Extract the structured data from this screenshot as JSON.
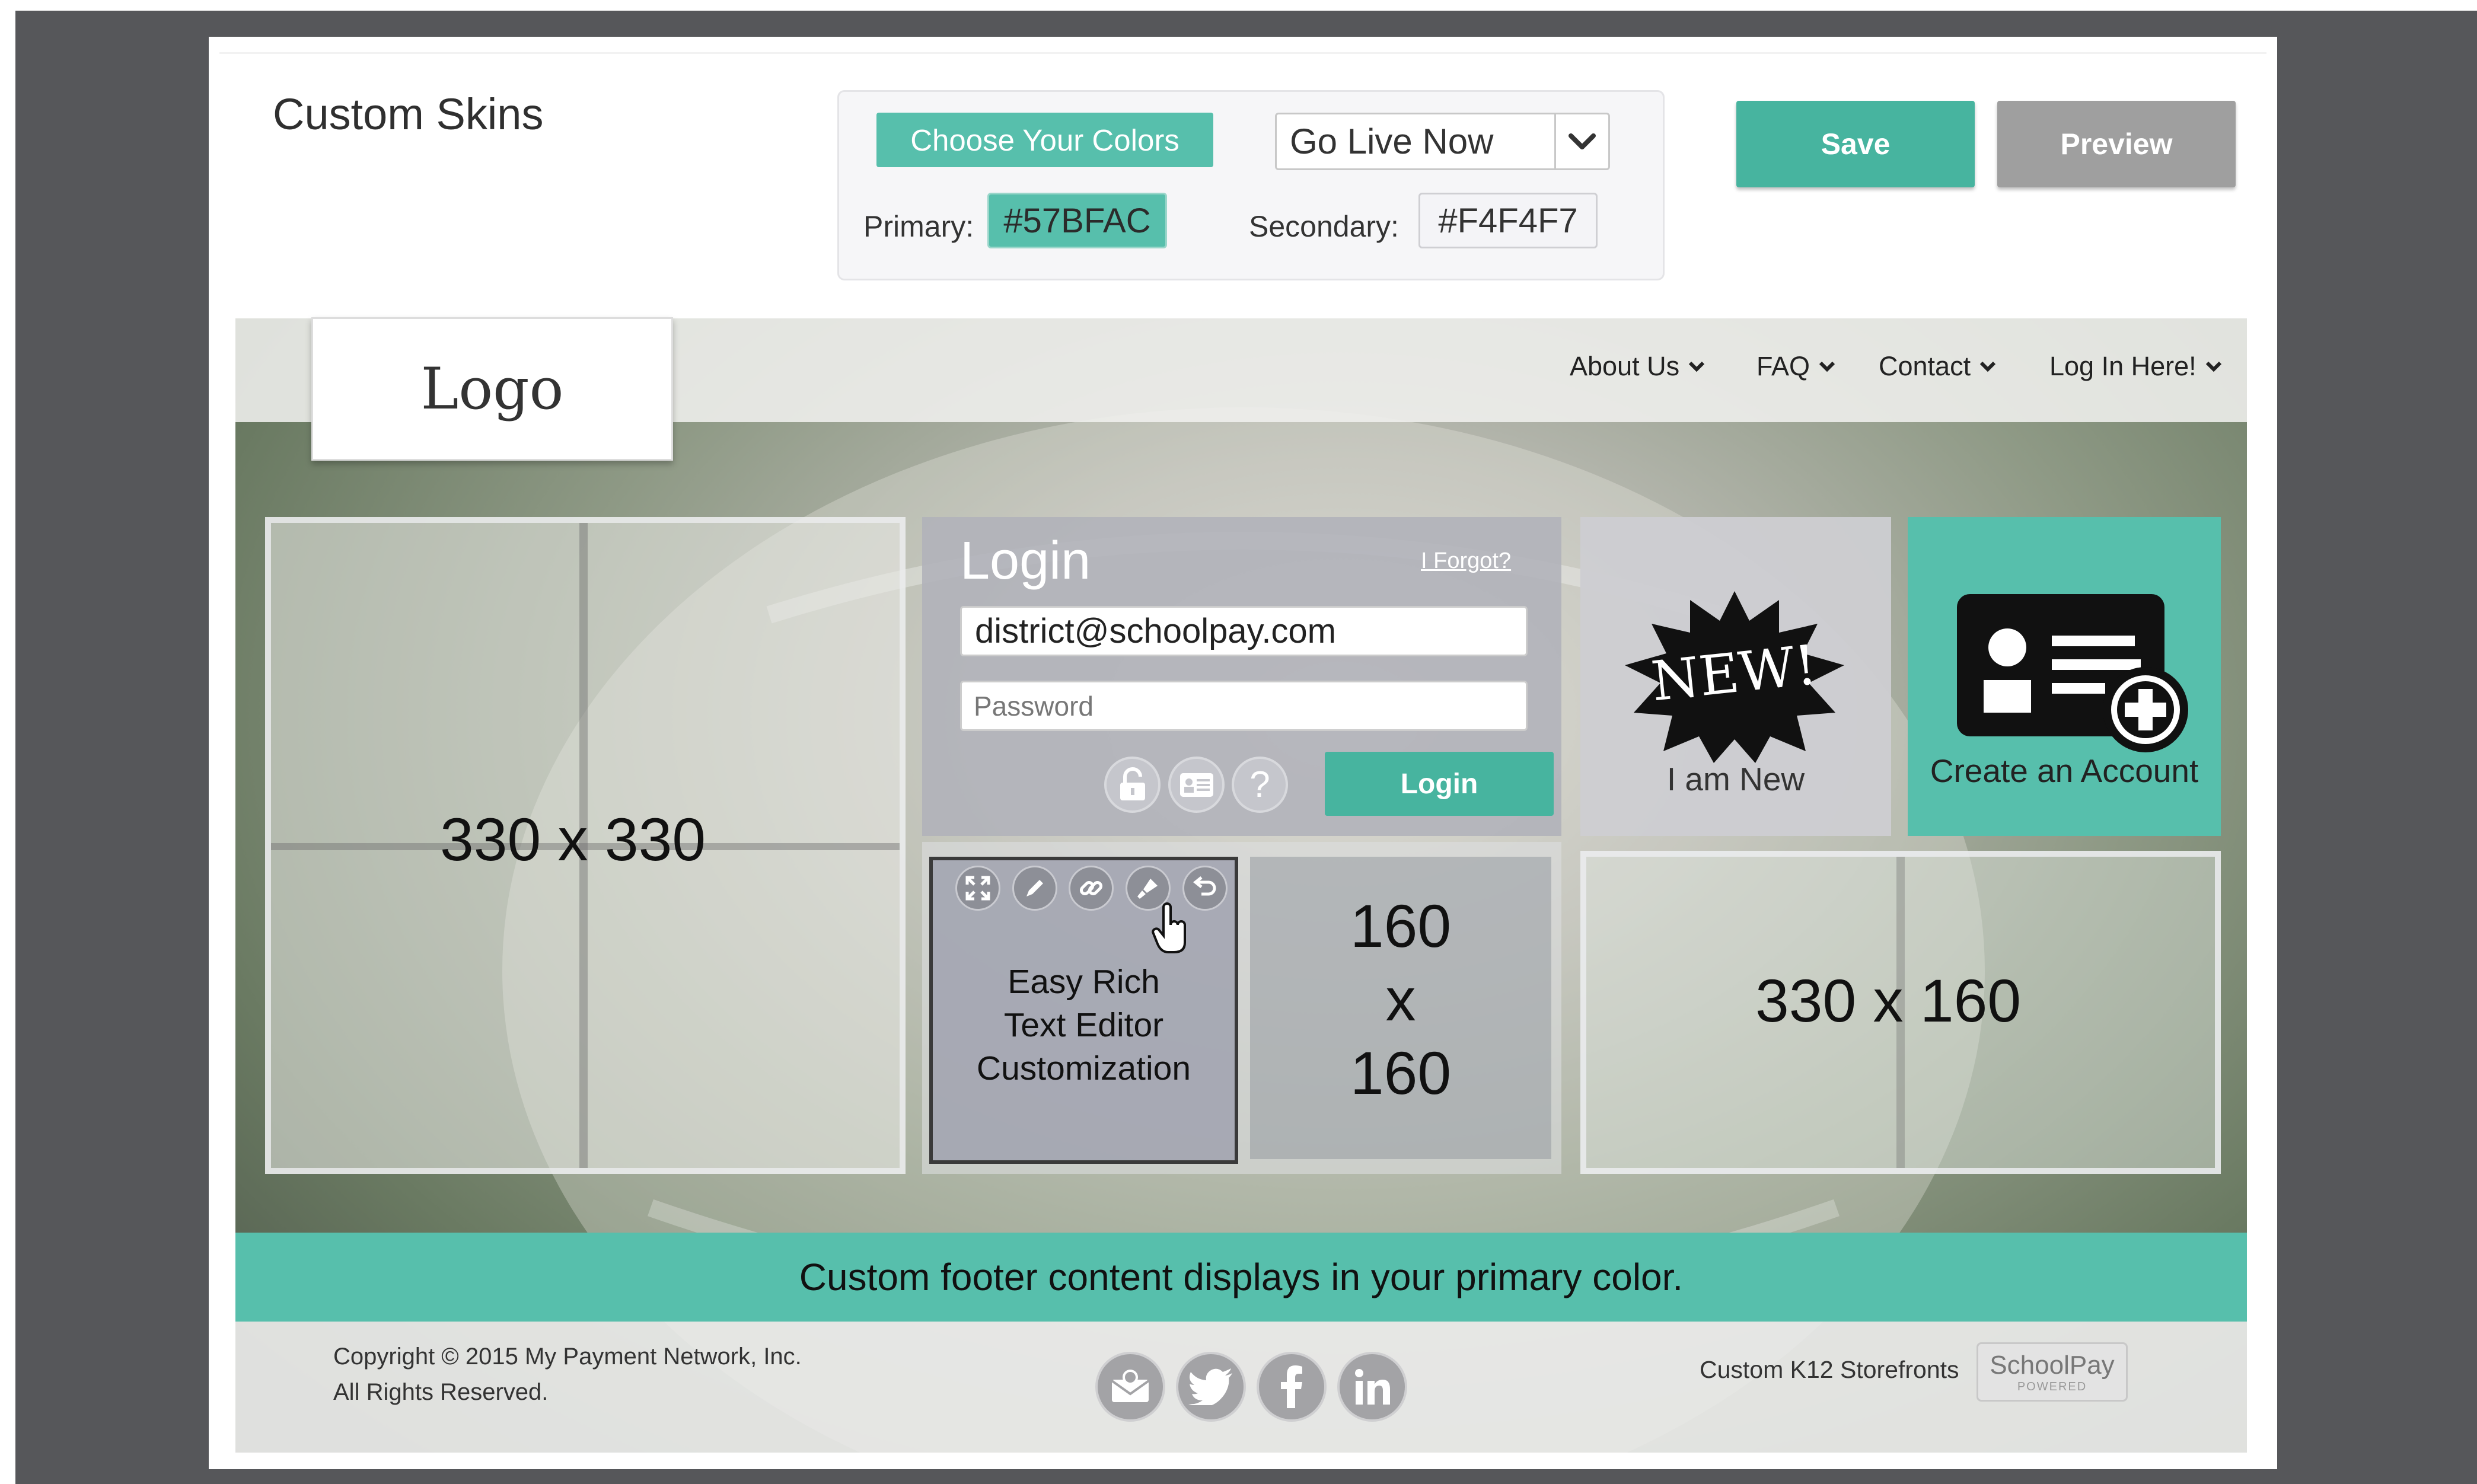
{
  "header": {
    "title": "Custom Skins",
    "choose_colors": "Choose Your Colors",
    "go_live_select": "Go Live Now",
    "primary_label": "Primary:",
    "primary_value": "#57BFAC",
    "secondary_label": "Secondary:",
    "secondary_value": "#F4F4F7",
    "save": "Save",
    "preview": "Preview"
  },
  "colors": {
    "primary": "#57BFAC",
    "secondary": "#F4F4F7"
  },
  "site": {
    "logo": "Logo",
    "nav": [
      "About Us",
      "FAQ",
      "Contact",
      "Log In Here!"
    ],
    "block_large": "330 x 330",
    "login": {
      "title": "Login",
      "forgot": "I Forgot?",
      "email_value": "district@schoolpay.com",
      "password_placeholder": "Password",
      "button": "Login"
    },
    "new_badge": "NEW!",
    "i_am_new": "I am New",
    "create_account": "Create an Account",
    "editor_text": [
      "Easy Rich",
      "Text Editor",
      "Customization"
    ],
    "block_small": [
      "160",
      "x",
      "160"
    ],
    "block_wide": "330 x 160",
    "footer_bar": "Custom footer content displays in your primary color.",
    "copyright": [
      "Copyright © 2015 My Payment Network, Inc.",
      "All Rights Reserved."
    ],
    "k12": "Custom K12 Storefronts",
    "schoolpay_logo": "SchoolPay",
    "schoolpay_tag": "POWERED"
  },
  "icons": {
    "login_row": [
      "unlock-icon",
      "id-card-icon",
      "help-icon"
    ],
    "editor_toolbar": [
      "expand-icon",
      "pencil-icon",
      "link-icon",
      "brush-icon",
      "undo-icon"
    ],
    "social": [
      "email-icon",
      "twitter-icon",
      "facebook-icon",
      "linkedin-icon"
    ]
  }
}
